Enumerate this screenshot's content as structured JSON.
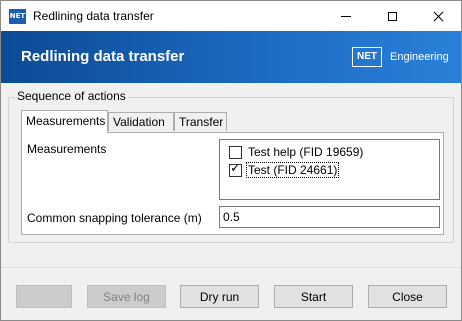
{
  "window": {
    "title": "Redlining data transfer",
    "icon_text": "NET"
  },
  "banner": {
    "title": "Redlining data transfer",
    "brand_logo": "NET",
    "brand_text": "Engineering"
  },
  "group": {
    "legend": "Sequence of actions"
  },
  "tabs": [
    {
      "label": "Measurements",
      "active": true
    },
    {
      "label": "Validation",
      "active": false
    },
    {
      "label": "Transfer",
      "active": false
    }
  ],
  "panel": {
    "measurements_label": "Measurements",
    "measurements": [
      {
        "label": "Test help (FID 19659)",
        "checked": false
      },
      {
        "label": "Test (FID 24661)",
        "checked": true
      }
    ],
    "tolerance_label": "Common snapping tolerance (m)",
    "tolerance_value": "0.5"
  },
  "buttons": {
    "blank": "",
    "save_log": "Save log",
    "dry_run": "Dry run",
    "start": "Start",
    "close": "Close"
  }
}
